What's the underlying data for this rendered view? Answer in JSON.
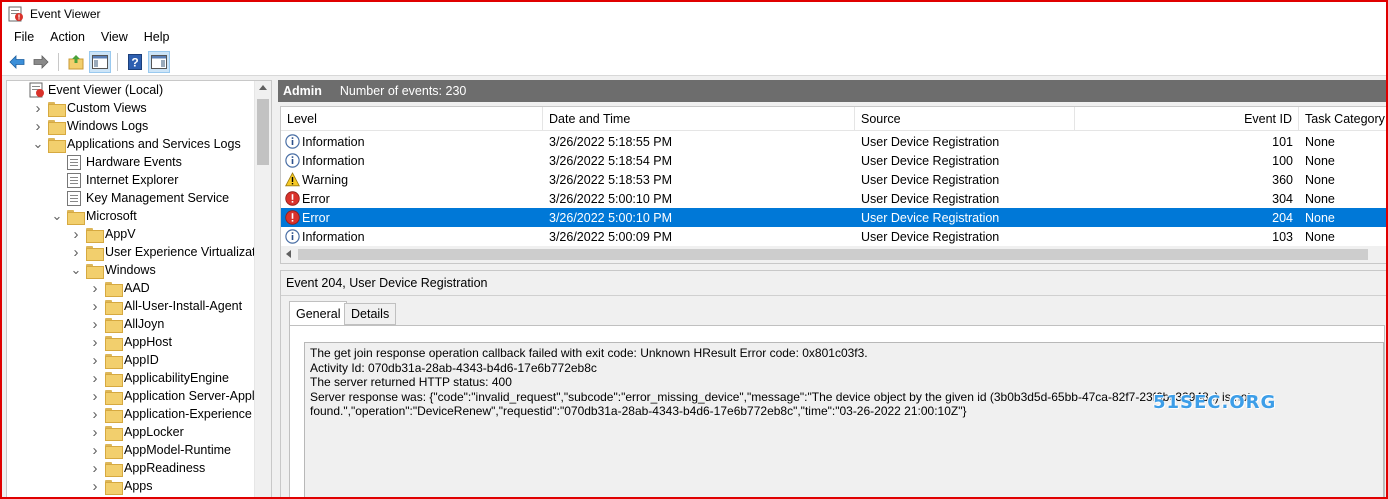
{
  "window": {
    "title": "Event Viewer"
  },
  "menu": [
    "File",
    "Action",
    "View",
    "Help"
  ],
  "toolbar": {
    "icons": [
      "back-arrow-icon",
      "forward-arrow-icon",
      "up-folder-icon",
      "show-hide-tree-icon",
      "help-icon",
      "action-pane-icon"
    ]
  },
  "tree": {
    "items": [
      {
        "label": "Event Viewer (Local)",
        "level": 0,
        "chevron": "",
        "icon": "event-viewer"
      },
      {
        "label": "Custom Views",
        "level": 1,
        "chevron": ">",
        "icon": "folder"
      },
      {
        "label": "Windows Logs",
        "level": 1,
        "chevron": ">",
        "icon": "folder"
      },
      {
        "label": "Applications and Services Logs",
        "level": 1,
        "chevron": "v",
        "icon": "folder"
      },
      {
        "label": "Hardware Events",
        "level": 2,
        "chevron": "",
        "icon": "log"
      },
      {
        "label": "Internet Explorer",
        "level": 2,
        "chevron": "",
        "icon": "log"
      },
      {
        "label": "Key Management Service",
        "level": 2,
        "chevron": "",
        "icon": "log"
      },
      {
        "label": "Microsoft",
        "level": 2,
        "chevron": "v",
        "icon": "folder"
      },
      {
        "label": "AppV",
        "level": 3,
        "chevron": ">",
        "icon": "folder"
      },
      {
        "label": "User Experience Virtualization",
        "level": 3,
        "chevron": ">",
        "icon": "folder"
      },
      {
        "label": "Windows",
        "level": 3,
        "chevron": "v",
        "icon": "folder"
      },
      {
        "label": "AAD",
        "level": 4,
        "chevron": ">",
        "icon": "folder"
      },
      {
        "label": "All-User-Install-Agent",
        "level": 4,
        "chevron": ">",
        "icon": "folder"
      },
      {
        "label": "AllJoyn",
        "level": 4,
        "chevron": ">",
        "icon": "folder"
      },
      {
        "label": "AppHost",
        "level": 4,
        "chevron": ">",
        "icon": "folder"
      },
      {
        "label": "AppID",
        "level": 4,
        "chevron": ">",
        "icon": "folder"
      },
      {
        "label": "ApplicabilityEngine",
        "level": 4,
        "chevron": ">",
        "icon": "folder"
      },
      {
        "label": "Application Server-Applicat",
        "level": 4,
        "chevron": ">",
        "icon": "folder"
      },
      {
        "label": "Application-Experience",
        "level": 4,
        "chevron": ">",
        "icon": "folder"
      },
      {
        "label": "AppLocker",
        "level": 4,
        "chevron": ">",
        "icon": "folder"
      },
      {
        "label": "AppModel-Runtime",
        "level": 4,
        "chevron": ">",
        "icon": "folder"
      },
      {
        "label": "AppReadiness",
        "level": 4,
        "chevron": ">",
        "icon": "folder"
      },
      {
        "label": "Apps",
        "level": 4,
        "chevron": ">",
        "icon": "folder"
      }
    ]
  },
  "header": {
    "log_name": "Admin",
    "count_text": "Number of events: 230"
  },
  "grid": {
    "columns": [
      "Level",
      "Date and Time",
      "Source",
      "Event ID",
      "Task Category"
    ],
    "rows": [
      {
        "level": "Information",
        "type": "info",
        "date": "3/26/2022 5:18:55 PM",
        "source": "User Device Registration",
        "id": "101",
        "category": "None",
        "selected": false
      },
      {
        "level": "Information",
        "type": "info",
        "date": "3/26/2022 5:18:54 PM",
        "source": "User Device Registration",
        "id": "100",
        "category": "None",
        "selected": false
      },
      {
        "level": "Warning",
        "type": "warning",
        "date": "3/26/2022 5:18:53 PM",
        "source": "User Device Registration",
        "id": "360",
        "category": "None",
        "selected": false
      },
      {
        "level": "Error",
        "type": "error",
        "date": "3/26/2022 5:00:10 PM",
        "source": "User Device Registration",
        "id": "304",
        "category": "None",
        "selected": false
      },
      {
        "level": "Error",
        "type": "error",
        "date": "3/26/2022 5:00:10 PM",
        "source": "User Device Registration",
        "id": "204",
        "category": "None",
        "selected": true
      },
      {
        "level": "Information",
        "type": "info",
        "date": "3/26/2022 5:00:09 PM",
        "source": "User Device Registration",
        "id": "103",
        "category": "None",
        "selected": false
      }
    ]
  },
  "detail": {
    "title": "Event 204, User Device Registration",
    "tabs": [
      "General",
      "Details"
    ],
    "active_tab": "General",
    "message_lines": [
      "The get join response operation callback failed with exit code: Unknown HResult Error code: 0x801c03f3.",
      "Activity Id: 070db31a-28ab-4343-b4d6-17e6b772eb8c",
      "The server returned HTTP status: 400",
      "Server response was: {\"code\":\"invalid_request\",\"subcode\":\"error_missing_device\",\"message\":\"The device object by the given id (3b0b3d5d-65bb-47ca-82f7-23f6bc32948c) is not",
      "found.\",\"operation\":\"DeviceRenew\",\"requestid\":\"070db31a-28ab-4343-b4d6-17e6b772eb8c\",\"time\":\"03-26-2022 21:00:10Z\"}"
    ]
  },
  "watermark": "51SEC.ORG",
  "colors": {
    "selection": "#0078d7",
    "header_bar": "#6d6d6d",
    "frame_border": "#e00000"
  }
}
